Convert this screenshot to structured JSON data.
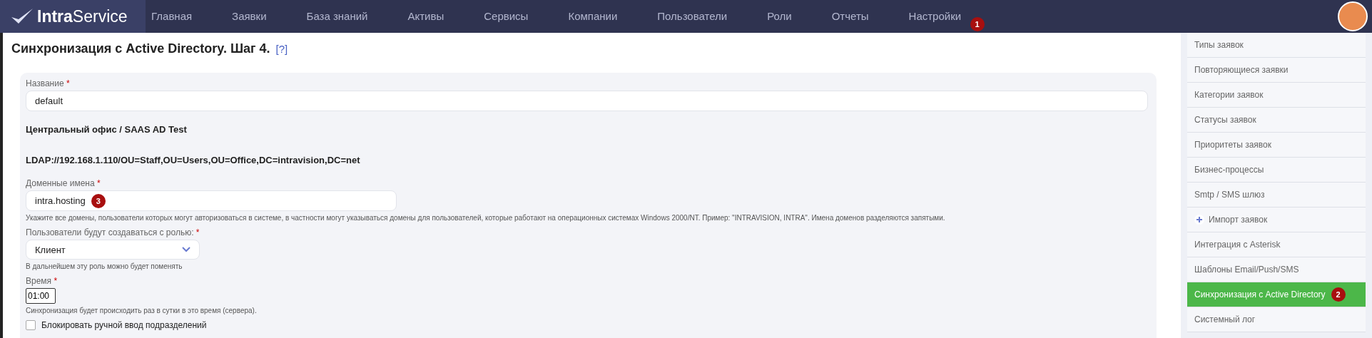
{
  "header": {
    "logo": {
      "bold": "Intra",
      "regular": "Service"
    },
    "nav": [
      {
        "label": "Главная"
      },
      {
        "label": "Заявки"
      },
      {
        "label": "База знаний"
      },
      {
        "label": "Активы"
      },
      {
        "label": "Сервисы"
      },
      {
        "label": "Компании"
      },
      {
        "label": "Пользователи"
      },
      {
        "label": "Роли"
      },
      {
        "label": "Отчеты"
      },
      {
        "label": "Настройки",
        "badge": "1"
      }
    ]
  },
  "page": {
    "title": "Синхронизация с Active Directory. Шаг 4.",
    "help": "[?]",
    "form": [
      {
        "kind": "text",
        "label": "Название",
        "required_mark": "*",
        "value": "default"
      },
      {
        "kind": "info",
        "text": "Центральный офис / SAAS AD Test"
      },
      {
        "kind": "info",
        "text": "LDAP://192.168.1.110/OU=Staff,OU=Users,OU=Office,DC=intravision,DC=net"
      },
      {
        "kind": "short",
        "label": "Доменные имена",
        "required_mark": "*",
        "value": "intra.hosting",
        "badge": "3",
        "hint": "Укажите все домены, пользователи которых могут авторизоваться в системе, в частности могут указываться домены для пользователей, которые работают на операционных системах Windows 2000/NT. Пример: \"INTRAVISION, INTRA\". Имена доменов разделяются запятыми."
      },
      {
        "kind": "select",
        "label": "Пользователи будут создаваться с ролью:",
        "required_mark": "*",
        "value": "Клиент",
        "hint": "В дальнейшем эту роль можно будет поменять"
      },
      {
        "kind": "time",
        "label": "Время",
        "required_mark": "*",
        "value": "01:00",
        "hint": "Синхронизация будет происходить раз в сутки в это время (сервера)."
      },
      {
        "kind": "checkbox",
        "label": "Блокировать ручной ввод подразделений",
        "checked": false
      }
    ]
  },
  "sidebar": {
    "items": [
      {
        "label": "Типы заявок",
        "selected": false
      },
      {
        "label": "Повторяющиеся заявки",
        "selected": false
      },
      {
        "label": "Категории заявок",
        "selected": false
      },
      {
        "label": "Статусы заявок",
        "selected": false
      },
      {
        "label": "Приоритеты заявок",
        "selected": false
      },
      {
        "label": "Бизнес-процессы",
        "selected": false
      },
      {
        "label": "Smtp / SMS шлюз",
        "selected": false
      },
      {
        "label": "Импорт заявок",
        "selected": false,
        "kind": "plus"
      },
      {
        "label": "Интеграция с Asterisk",
        "selected": false
      },
      {
        "label": "Шаблоны Email/Push/SMS",
        "selected": false
      },
      {
        "label": "Синхронизация с Active Directory",
        "selected": true,
        "badge": "2"
      },
      {
        "label": "Системный лог",
        "selected": false
      }
    ]
  }
}
